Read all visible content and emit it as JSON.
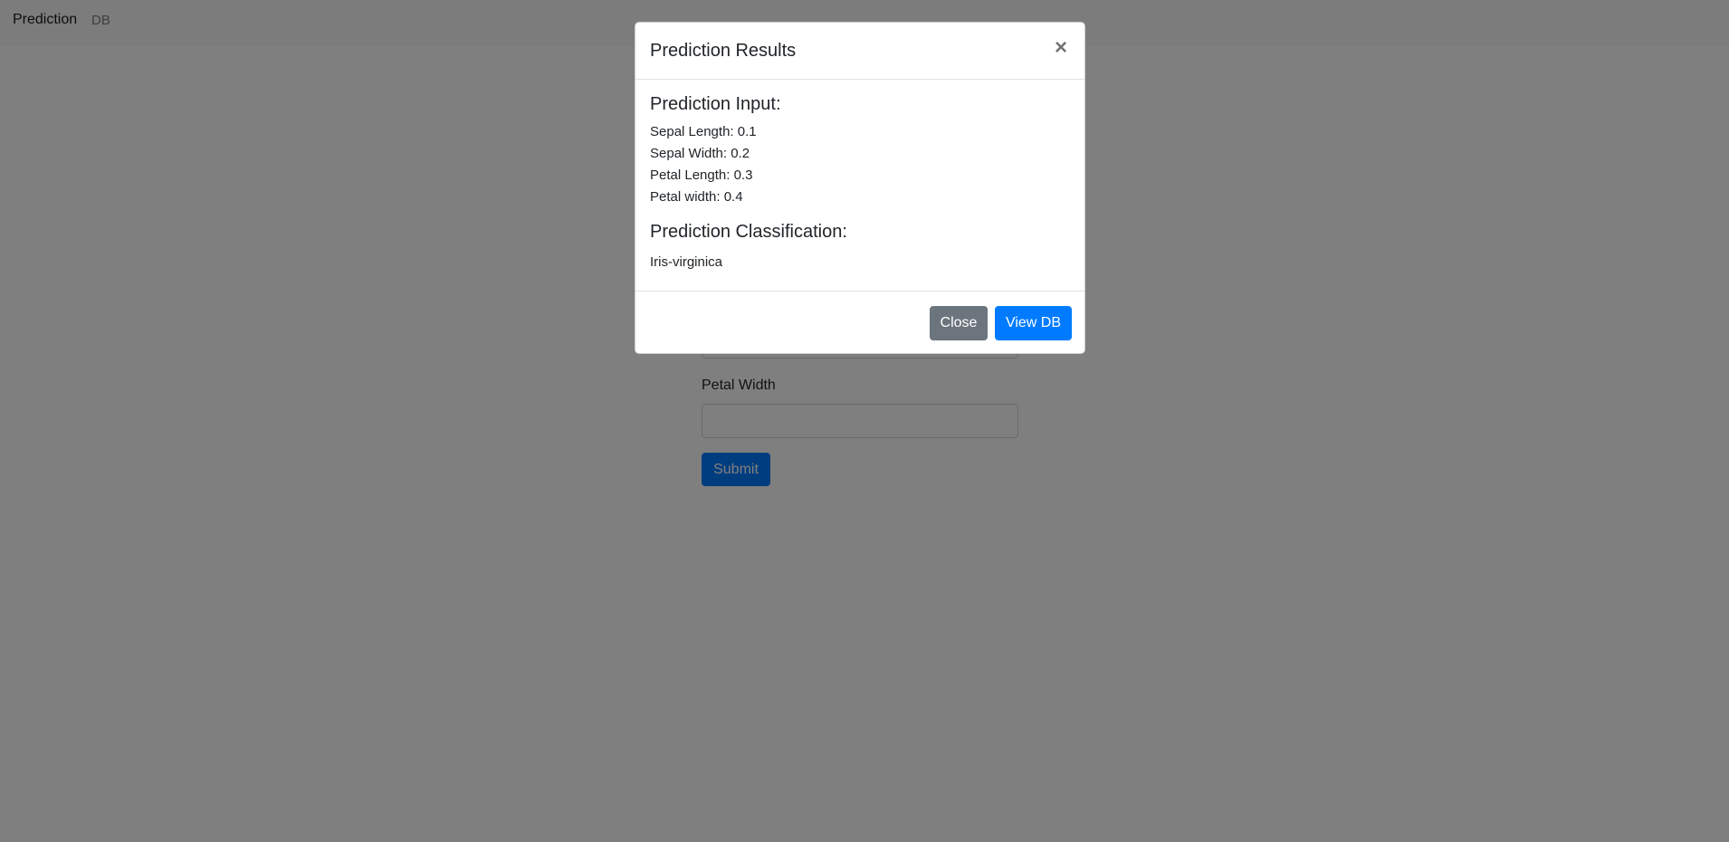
{
  "navbar": {
    "brand": "Prediction",
    "links": [
      "DB"
    ]
  },
  "form": {
    "petal_width_label": "Petal Width",
    "submit_label": "Submit"
  },
  "modal": {
    "title": "Prediction Results",
    "close_symbol": "×",
    "input_heading": "Prediction Input:",
    "inputs": [
      "Sepal Length: 0.1",
      "Sepal Width: 0.2",
      "Petal Length: 0.3",
      "Petal width: 0.4"
    ],
    "classification_heading": "Prediction Classification:",
    "classification": "Iris-virginica",
    "footer": {
      "close_label": "Close",
      "view_db_label": "View DB"
    }
  },
  "colors": {
    "primary": "#007bff",
    "secondary": "#6c757d",
    "backdrop": "rgba(0,0,0,0.5)"
  }
}
